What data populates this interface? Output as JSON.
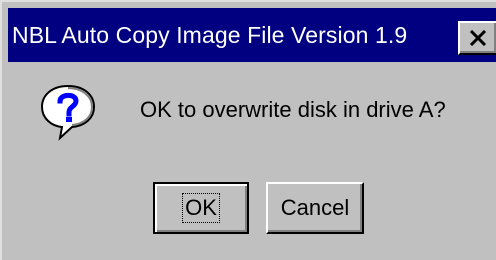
{
  "dialog": {
    "title": "NBL Auto Copy Image File Version 1.9",
    "message": "OK to overwrite disk in drive A?",
    "icon": "question-icon",
    "ok_label": "OK",
    "cancel_label": "Cancel",
    "close_icon": "close-icon"
  },
  "colors": {
    "title_bar": "#000080",
    "face": "#c0c0c0",
    "title_text": "#ffffff"
  }
}
